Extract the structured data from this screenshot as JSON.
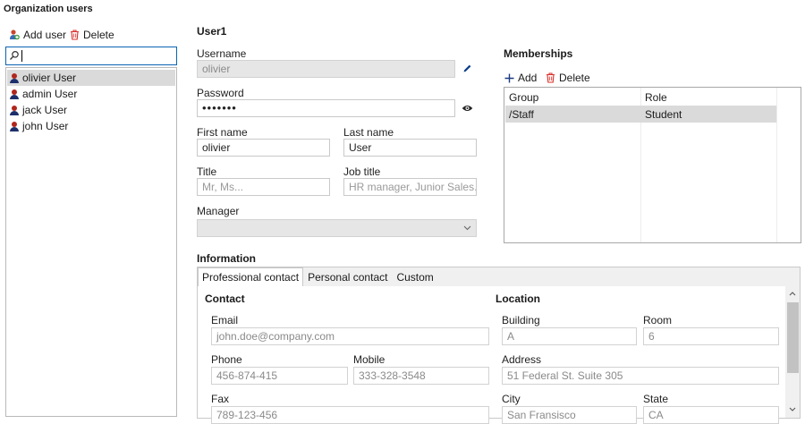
{
  "page": {
    "title": "Organization users"
  },
  "toolbar": {
    "add_user": "Add user",
    "delete": "Delete"
  },
  "search": {
    "value": ""
  },
  "users": [
    {
      "label": "olivier User",
      "selected": true
    },
    {
      "label": "admin User",
      "selected": false
    },
    {
      "label": "jack User",
      "selected": false
    },
    {
      "label": "john User",
      "selected": false
    }
  ],
  "detail": {
    "title": "User1",
    "username": {
      "label": "Username",
      "value": "olivier"
    },
    "password": {
      "label": "Password",
      "value": "•••••••"
    },
    "first_name": {
      "label": "First name",
      "value": "olivier"
    },
    "last_name": {
      "label": "Last name",
      "value": "User"
    },
    "title_field": {
      "label": "Title",
      "placeholder": "Mr, Ms..."
    },
    "job_title": {
      "label": "Job title",
      "placeholder": "HR manager, Junior Sales..."
    },
    "manager": {
      "label": "Manager",
      "value": ""
    }
  },
  "memberships": {
    "title": "Memberships",
    "add": "Add",
    "delete": "Delete",
    "columns": [
      "Group",
      "Role"
    ],
    "rows": [
      {
        "group": "/Staff",
        "role": "Student"
      }
    ]
  },
  "information": {
    "title": "Information",
    "tabs": [
      "Professional contact",
      "Personal contact",
      "Custom"
    ],
    "active_tab": "Professional contact",
    "contact": {
      "heading": "Contact",
      "email": {
        "label": "Email",
        "value": "john.doe@company.com"
      },
      "phone": {
        "label": "Phone",
        "value": "456-874-415"
      },
      "mobile": {
        "label": "Mobile",
        "value": "333-328-3548"
      },
      "fax": {
        "label": "Fax",
        "value": "789-123-456"
      }
    },
    "location": {
      "heading": "Location",
      "building": {
        "label": "Building",
        "value": "A"
      },
      "room": {
        "label": "Room",
        "value": "6"
      },
      "address": {
        "label": "Address",
        "value": "51 Federal St. Suite 305"
      },
      "city": {
        "label": "City",
        "value": "San Fransisco"
      },
      "state": {
        "label": "State",
        "value": "CA"
      }
    }
  },
  "icons": {
    "add_user": "add-user-icon",
    "delete": "trash-icon",
    "search": "search-icon",
    "edit": "pencil-icon",
    "show_password": "eye-icon",
    "user": "user-icon",
    "dropdown": "chevron-down-icon",
    "add": "plus-icon"
  },
  "colors": {
    "accent": "#0a64b4",
    "delete": "#d9302a",
    "user_head": "#b0261d",
    "user_body": "#1d2f6b",
    "selected_row": "#dadada"
  }
}
